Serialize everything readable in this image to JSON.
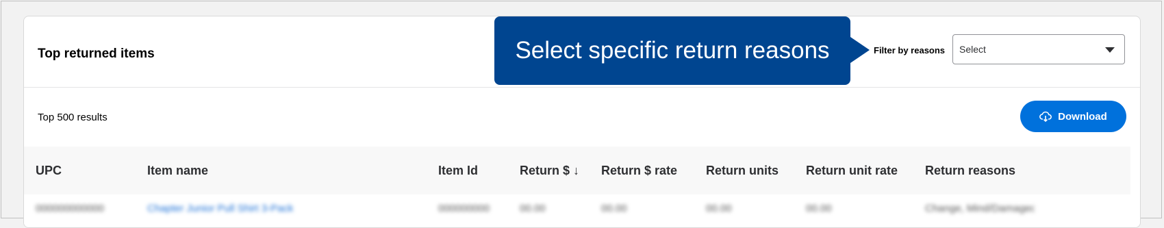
{
  "card": {
    "title": "Top returned items",
    "filter_label": "Filter by reasons",
    "filter_select": {
      "value": "Select"
    },
    "results_text": "Top 500 results",
    "download_label": "Download"
  },
  "tooltip": {
    "text": "Select specific return reasons"
  },
  "table": {
    "columns": [
      "UPC",
      "Item name",
      "Item Id",
      "Return $ ↓",
      "Return $ rate",
      "Return units",
      "Return unit rate",
      "Return reasons"
    ],
    "rows": [
      [
        "000000000000",
        "Chapter Junior Pull Shirt 3-Pack",
        "000000000",
        "00.00",
        "00.00",
        "00.00",
        "00.00",
        "Change, Mind/Damaged..."
      ]
    ]
  },
  "colors": {
    "accent": "#0071dc",
    "tooltip": "#004590"
  },
  "icons": {
    "download": "cloud-download-icon",
    "select": "caret-down-icon"
  }
}
